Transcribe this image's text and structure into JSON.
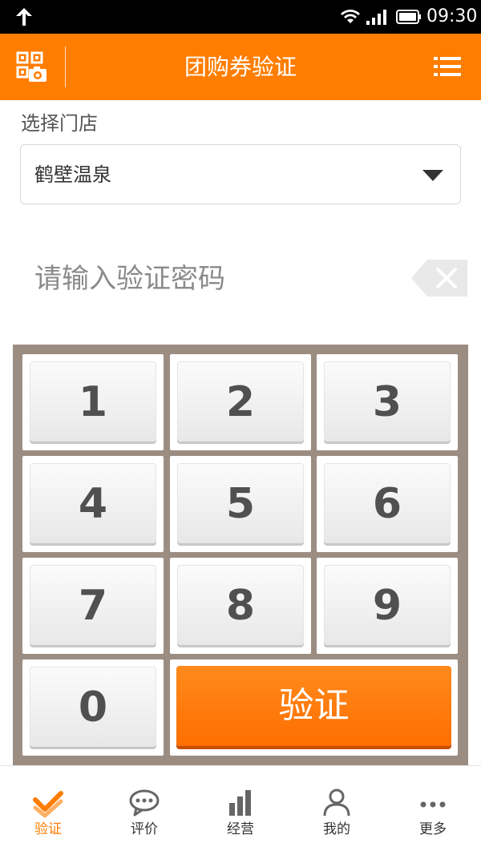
{
  "status_bar": {
    "time": "09:30"
  },
  "header": {
    "title": "团购券验证"
  },
  "store": {
    "label": "选择门店",
    "selected": "鹤壁温泉"
  },
  "password": {
    "placeholder": "请输入验证密码"
  },
  "keypad": {
    "keys": [
      "1",
      "2",
      "3",
      "4",
      "5",
      "6",
      "7",
      "8",
      "9",
      "0"
    ],
    "verify_label": "验证"
  },
  "bottom_nav": {
    "items": [
      {
        "label": "验证",
        "icon": "verify-check-icon",
        "active": true
      },
      {
        "label": "评价",
        "icon": "chat-bubble-icon",
        "active": false
      },
      {
        "label": "经营",
        "icon": "bar-chart-icon",
        "active": false
      },
      {
        "label": "我的",
        "icon": "user-icon",
        "active": false
      },
      {
        "label": "更多",
        "icon": "more-dots-icon",
        "active": false
      }
    ]
  },
  "colors": {
    "accent": "#ff7d00",
    "keypad_bg": "#9c8d82",
    "text": "#333333"
  }
}
